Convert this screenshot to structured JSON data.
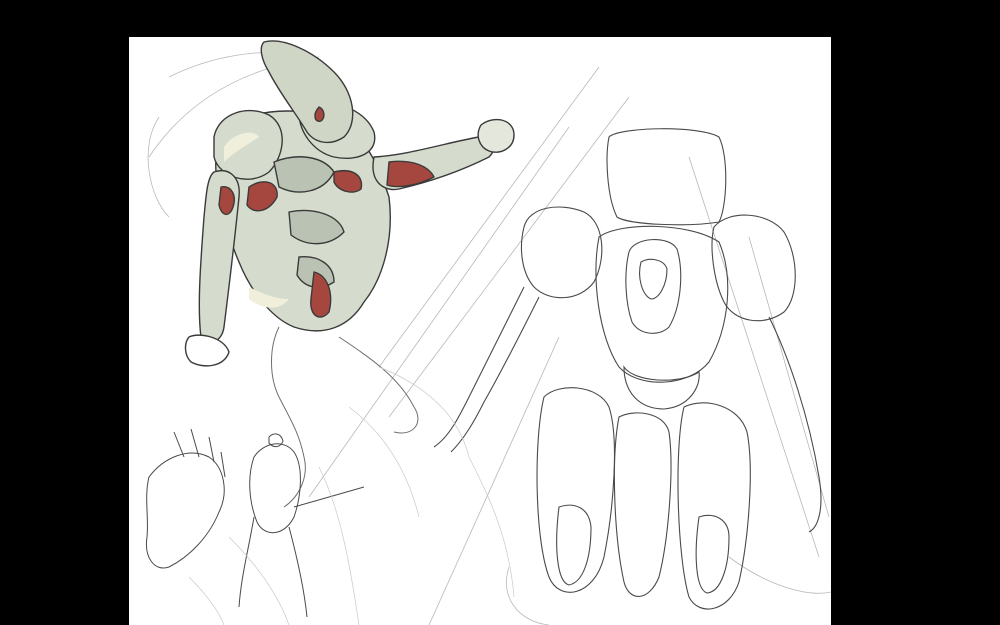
{
  "window": {
    "background_color": "#000000"
  },
  "canvas": {
    "background_color": "#ffffff",
    "zoom": null
  },
  "artwork": {
    "icons": [
      "sketch-illustration"
    ],
    "colors": {
      "line": "#3a3a3a",
      "sketch": "#9a9a9a",
      "skin": "#d6dccd",
      "skin_shadow": "#b9c2b3",
      "highlight": "#f0efdc",
      "red_panel": "#a6473f"
    }
  }
}
